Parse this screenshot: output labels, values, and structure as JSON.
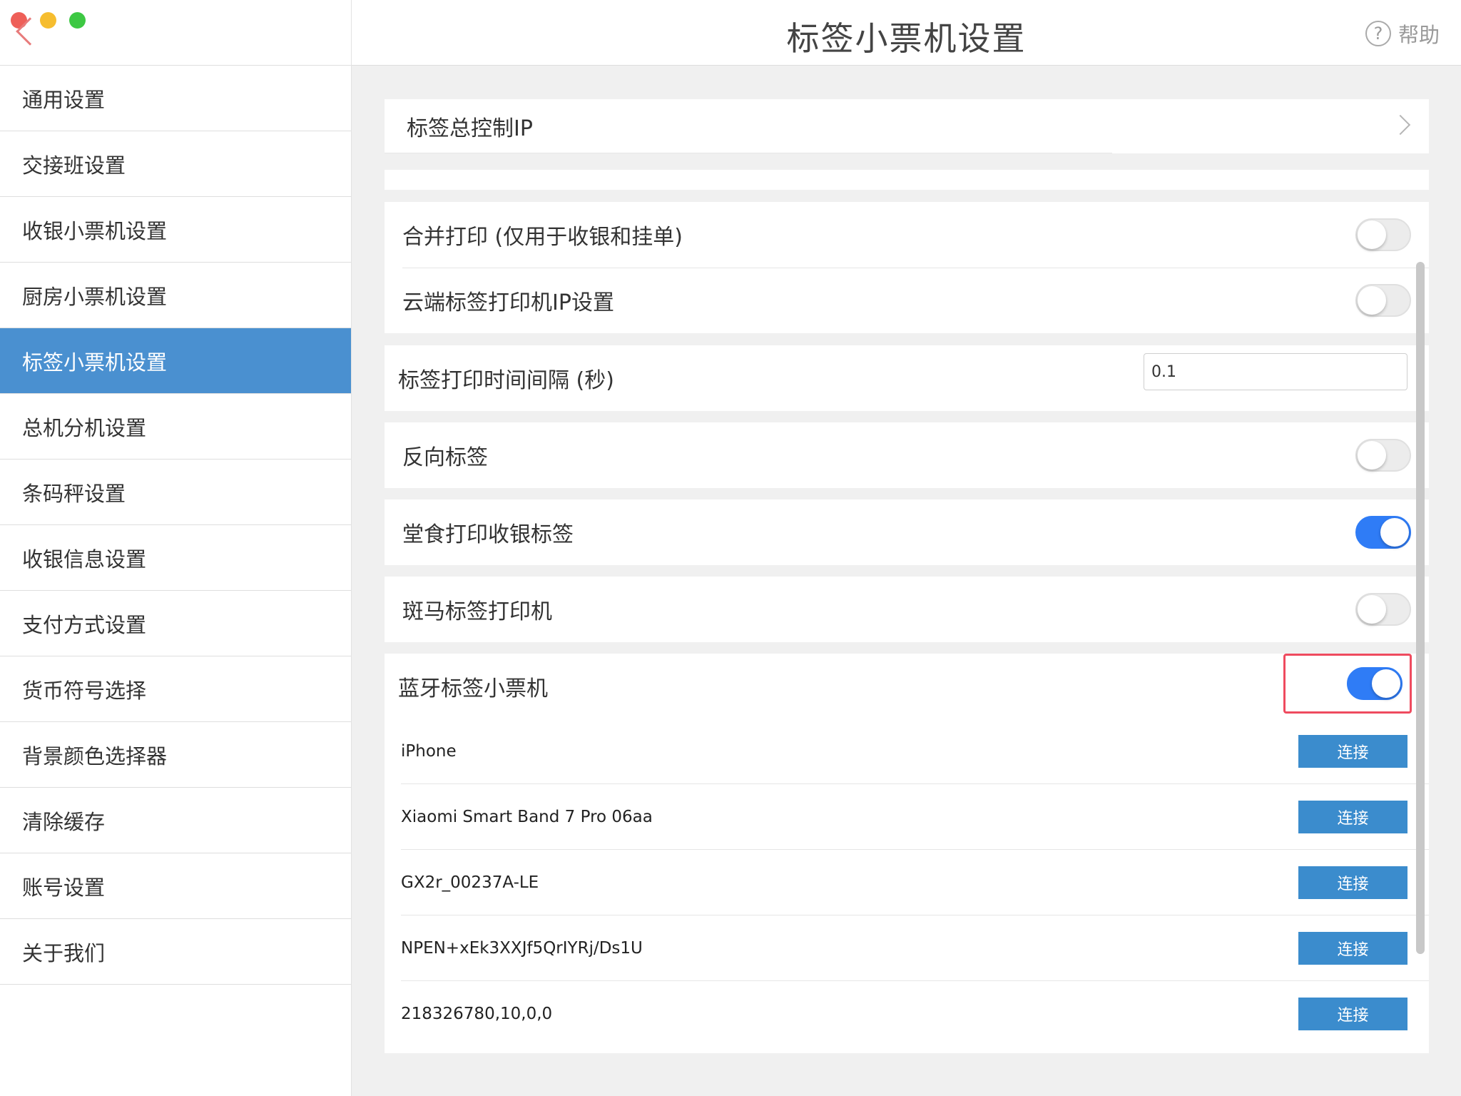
{
  "header": {
    "title": "标签小票机设置",
    "help_label": "帮助",
    "help_icon": "?"
  },
  "sidebar": {
    "items": [
      {
        "label": "通用设置",
        "active": false
      },
      {
        "label": "交接班设置",
        "active": false
      },
      {
        "label": "收银小票机设置",
        "active": false
      },
      {
        "label": "厨房小票机设置",
        "active": false
      },
      {
        "label": "标签小票机设置",
        "active": true
      },
      {
        "label": "总机分机设置",
        "active": false
      },
      {
        "label": "条码秤设置",
        "active": false
      },
      {
        "label": "收银信息设置",
        "active": false
      },
      {
        "label": "支付方式设置",
        "active": false
      },
      {
        "label": "货币符号选择",
        "active": false
      },
      {
        "label": "背景颜色选择器",
        "active": false
      },
      {
        "label": "清除缓存",
        "active": false
      },
      {
        "label": "账号设置",
        "active": false
      },
      {
        "label": "关于我们",
        "active": false
      }
    ]
  },
  "settings": {
    "master_ip": {
      "label": "标签总控制IP"
    },
    "merge_print": {
      "label": "合并打印 (仅用于收银和挂单)",
      "enabled": false
    },
    "cloud_ip": {
      "label": "云端标签打印机IP设置",
      "enabled": false
    },
    "interval": {
      "label": "标签打印时间间隔 (秒)",
      "value": "0.1"
    },
    "reverse": {
      "label": "反向标签",
      "enabled": false
    },
    "dine_in": {
      "label": "堂食打印收银标签",
      "enabled": true
    },
    "zebra": {
      "label": "斑马标签打印机",
      "enabled": false
    },
    "bluetooth": {
      "label": "蓝牙标签小票机",
      "enabled": true
    }
  },
  "devices": {
    "connect_label": "连接",
    "items": [
      {
        "name": "iPhone"
      },
      {
        "name": "Xiaomi Smart Band 7 Pro 06aa"
      },
      {
        "name": "GX2r_00237A-LE"
      },
      {
        "name": "NPEN+xEk3XXJf5QrIYRj/Ds1U"
      },
      {
        "name": "218326780,10,0,0"
      }
    ]
  },
  "colors": {
    "accent": "#4a90d0",
    "toggle_on": "#2f7cf6",
    "button": "#3b8ccd",
    "highlight": "#ef4b5f"
  }
}
